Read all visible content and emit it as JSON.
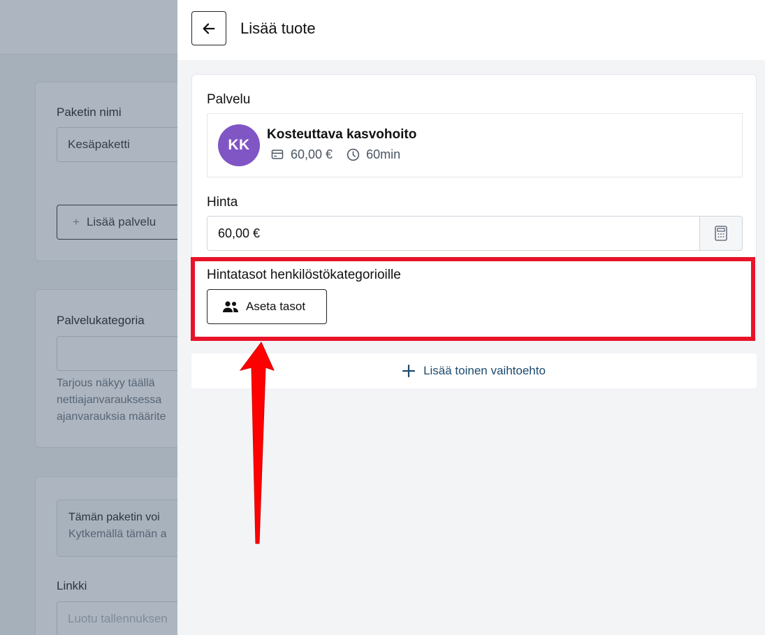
{
  "background": {
    "package_name_label": "Paketin nimi",
    "package_name_value": "Kesäpaketti",
    "add_service_label": "Lisää palvelu",
    "category_label": "Palvelukategoria",
    "category_help": [
      "Tarjous näkyy täällä",
      "nettiajanvarauksessa",
      "ajanvarauksia määrite"
    ],
    "notice_title": "Tämän paketin voi",
    "notice_text": "Kytkemällä tämän a",
    "link_label": "Linkki",
    "link_placeholder": "Luotu tallennuksen"
  },
  "drawer": {
    "title": "Lisää tuote",
    "service_section_label": "Palvelu",
    "service": {
      "avatar_initials": "KK",
      "name": "Kosteuttava kasvohoito",
      "price": "60,00 €",
      "duration": "60min"
    },
    "price_section_label": "Hinta",
    "price_value": "60,00 €",
    "tiers_section_label": "Hintatasot henkilöstökategorioille",
    "tiers_button_label": "Aseta tasot",
    "add_option_label": "Lisää toinen vaihtoehto"
  },
  "colors": {
    "avatar": "#8055c4",
    "highlight": "#e8132a",
    "link_text": "#1c4a6e"
  }
}
